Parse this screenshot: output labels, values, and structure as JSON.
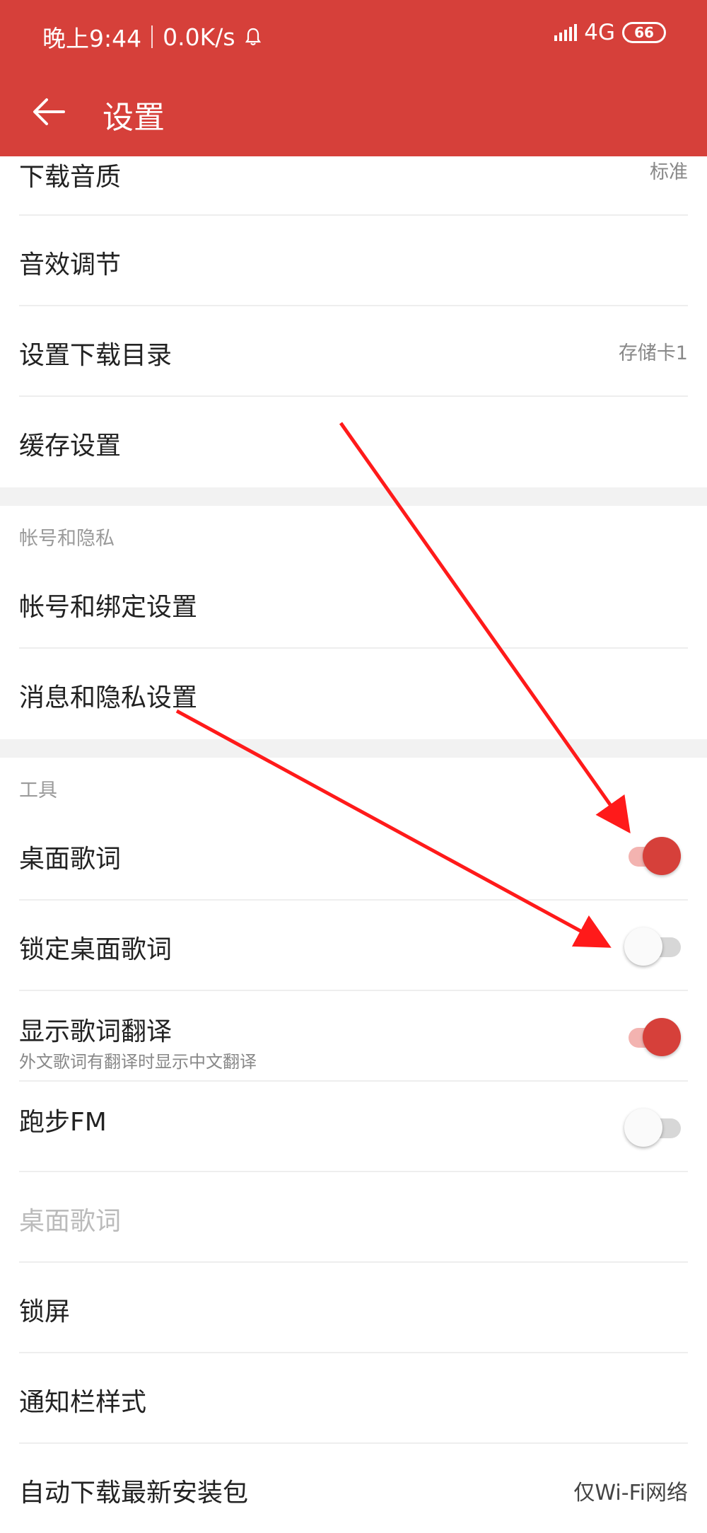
{
  "status_bar": {
    "time": "晚上9:44",
    "speed": "0.0K/s",
    "network": "4G",
    "battery": "66"
  },
  "app_bar": {
    "title": "设置"
  },
  "rows_top": [
    {
      "label": "下载音质",
      "value": "标准"
    },
    {
      "label": "音效调节",
      "value": ""
    },
    {
      "label": "设置下载目录",
      "value": "存储卡1"
    },
    {
      "label": "缓存设置",
      "value": ""
    }
  ],
  "section_account": {
    "title": "帐号和隐私",
    "items": [
      {
        "label": "帐号和绑定设置"
      },
      {
        "label": "消息和隐私设置"
      }
    ]
  },
  "section_tools": {
    "title": "工具",
    "items": [
      {
        "label": "桌面歌词",
        "toggle": "on"
      },
      {
        "label": "锁定桌面歌词",
        "toggle": "off"
      },
      {
        "label": "显示歌词翻译",
        "sub": "外文歌词有翻译时显示中文翻译",
        "toggle": "on"
      },
      {
        "label": "跑步FM",
        "toggle": "off"
      },
      {
        "label": "桌面歌词",
        "toggle": null
      },
      {
        "label": "锁屏",
        "toggle": null
      },
      {
        "label": "通知栏样式",
        "toggle": null
      },
      {
        "label": "自动下载最新安装包",
        "value": "仅Wi-Fi网络"
      }
    ]
  },
  "colors": {
    "accent": "#d6403a",
    "arrow": "#ff1a1a"
  },
  "icons": {
    "back": "back-arrow-icon",
    "notification": "bell-icon",
    "signal": "signal-icon"
  }
}
